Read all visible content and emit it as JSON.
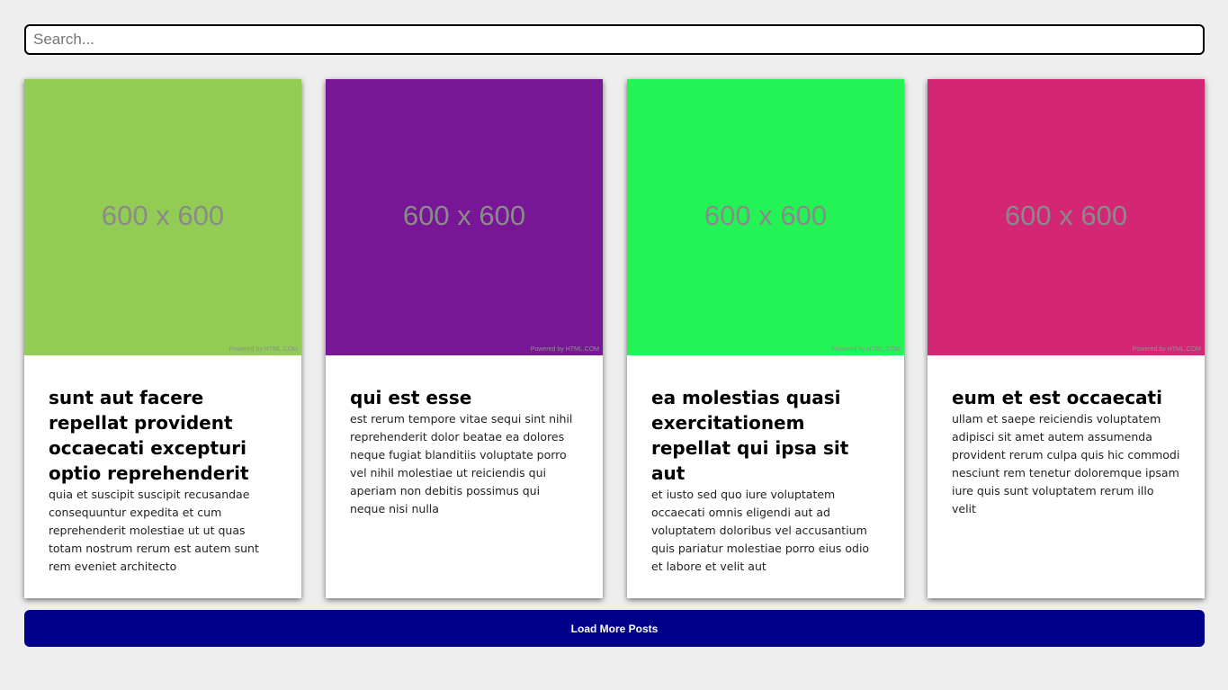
{
  "search": {
    "placeholder": "Search...",
    "value": ""
  },
  "colors": {
    "page_background": "#eeeeee",
    "button_background": "#00008b",
    "card_image_colors": [
      "#92cc54",
      "#771796",
      "#24f355",
      "#d32776"
    ]
  },
  "posts": [
    {
      "image_label": "600 x 600",
      "image_credit": "Powered by HTML.COM",
      "title": "sunt aut facere repellat provident occaecati excepturi optio reprehenderit",
      "body": "quia et suscipit suscipit recusandae consequuntur expedita et cum reprehenderit molestiae ut ut quas totam nostrum rerum est autem sunt rem eveniet architecto"
    },
    {
      "image_label": "600 x 600",
      "image_credit": "Powered by HTML.COM",
      "title": "qui est esse",
      "body": "est rerum tempore vitae sequi sint nihil reprehenderit dolor beatae ea dolores neque fugiat blanditiis voluptate porro vel nihil molestiae ut reiciendis qui aperiam non debitis possimus qui neque nisi nulla"
    },
    {
      "image_label": "600 x 600",
      "image_credit": "Powered by HTML.COM",
      "title": "ea molestias quasi exercitationem repellat qui ipsa sit aut",
      "body": "et iusto sed quo iure voluptatem occaecati omnis eligendi aut ad voluptatem doloribus vel accusantium quis pariatur molestiae porro eius odio et labore et velit aut"
    },
    {
      "image_label": "600 x 600",
      "image_credit": "Powered by HTML.COM",
      "title": "eum et est occaecati",
      "body": "ullam et saepe reiciendis voluptatem adipisci sit amet autem assumenda provident rerum culpa quis hic commodi nesciunt rem tenetur doloremque ipsam iure quis sunt voluptatem rerum illo velit"
    }
  ],
  "load_more": {
    "label": "Load More Posts"
  }
}
